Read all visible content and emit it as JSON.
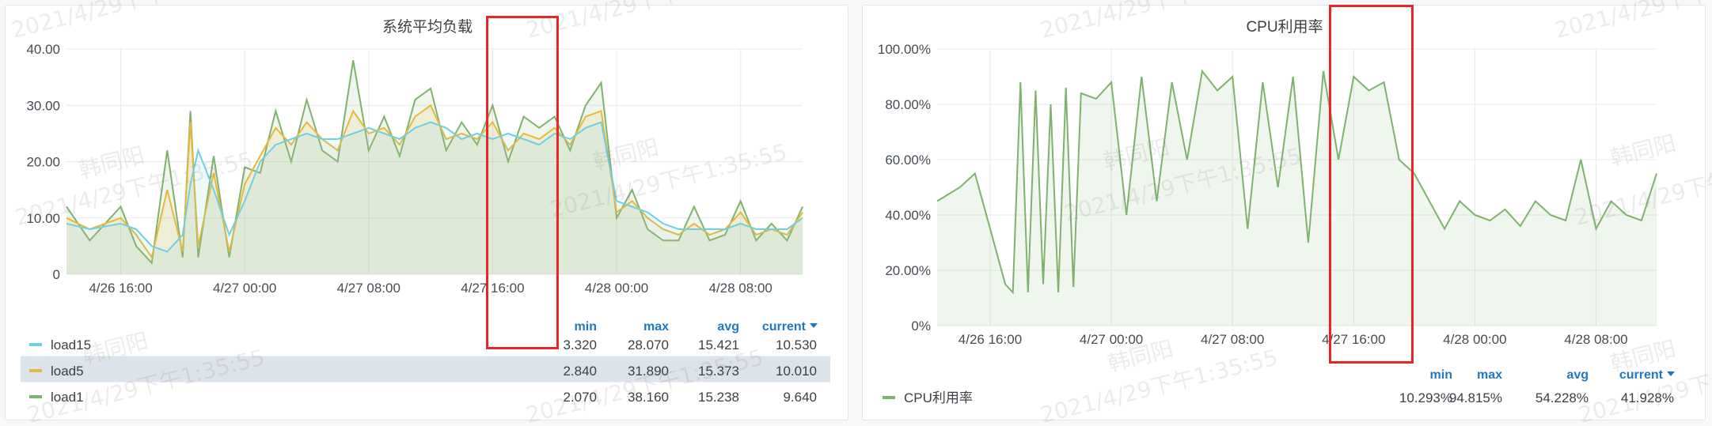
{
  "colors": {
    "load15": "#6ed0e0",
    "load5": "#eab839",
    "load1": "#7eb26d",
    "cpu": "#7eb26d",
    "legend_header": "#1f78c1",
    "highlight": "#e8262a",
    "grid": "#e8e9ec",
    "panel_border": "#e3e5e8",
    "selected_row": "#dde3ea"
  },
  "watermark": {
    "user": "韩同阳",
    "timestamp": "2021/4/29下午1:35:55"
  },
  "load_panel": {
    "title": "系统平均负载",
    "legend_headers": {
      "min": "min",
      "max": "max",
      "avg": "avg",
      "current": "current"
    },
    "sort_icon": "caret-down-icon",
    "legend_rows": [
      {
        "key": "load15",
        "name": "load15",
        "min": "3.320",
        "max": "28.070",
        "avg": "15.421",
        "current": "10.530",
        "selected": false
      },
      {
        "key": "load5",
        "name": "load5",
        "min": "2.840",
        "max": "31.890",
        "avg": "15.373",
        "current": "10.010",
        "selected": true
      },
      {
        "key": "load1",
        "name": "load1",
        "min": "2.070",
        "max": "38.160",
        "avg": "15.238",
        "current": "9.640",
        "selected": false
      }
    ]
  },
  "cpu_panel": {
    "title": "CPU利用率",
    "legend_headers": {
      "min": "min",
      "max": "max",
      "avg": "avg",
      "current": "current"
    },
    "sort_icon": "caret-down-icon",
    "legend_rows": [
      {
        "key": "cpu",
        "name": "CPU利用率",
        "min": "10.293%",
        "max": "94.815%",
        "avg": "54.228%",
        "current": "41.928%",
        "selected": false
      }
    ]
  },
  "chart_data": [
    {
      "type": "line",
      "title": "系统平均负载",
      "x_ticks": [
        "4/26 16:00",
        "4/27 00:00",
        "4/27 08:00",
        "4/27 16:00",
        "4/28 00:00",
        "4/28 08:00"
      ],
      "x_range_hours": [
        -3.5,
        44.0
      ],
      "y_ticks": [
        "0",
        "10.00",
        "20.00",
        "30.00",
        "40.00"
      ],
      "ylim": [
        0,
        40
      ],
      "grid": true,
      "fill": true,
      "legend": "bottom-table",
      "series": [
        {
          "name": "load15",
          "x_hours": [
            -3.5,
            -2,
            0,
            1,
            2,
            3,
            4,
            4.5,
            5,
            6,
            7,
            8,
            9,
            10,
            11,
            12,
            13,
            14,
            15,
            16,
            17,
            18,
            19,
            20,
            21,
            22,
            23,
            24,
            25,
            26,
            27,
            28,
            29,
            30,
            31,
            32,
            33,
            34,
            35,
            36,
            37,
            38,
            39,
            40,
            41,
            42,
            43,
            44
          ],
          "values": [
            9,
            8,
            9,
            8,
            5,
            4,
            7,
            16,
            22,
            15,
            7,
            13,
            20,
            23,
            24,
            25,
            24,
            24,
            25,
            26,
            25,
            24,
            26,
            27,
            26,
            24,
            25,
            24,
            25,
            24,
            23,
            25,
            24,
            26,
            27,
            13,
            12,
            11,
            9,
            8,
            8,
            8,
            8,
            9,
            8,
            8,
            8,
            10
          ]
        },
        {
          "name": "load5",
          "x_hours": [
            -3.5,
            -2,
            0,
            1,
            2,
            3,
            4,
            4.5,
            5,
            6,
            7,
            8,
            9,
            10,
            11,
            12,
            13,
            14,
            15,
            16,
            17,
            18,
            19,
            20,
            21,
            22,
            23,
            24,
            25,
            26,
            27,
            28,
            29,
            30,
            31,
            32,
            33,
            34,
            35,
            36,
            37,
            38,
            39,
            40,
            41,
            42,
            43,
            44
          ],
          "values": [
            10,
            8,
            10,
            7,
            3,
            15,
            4,
            27,
            5,
            18,
            4,
            16,
            21,
            26,
            23,
            27,
            24,
            22,
            29,
            25,
            26,
            23,
            28,
            30,
            24,
            25,
            24,
            27,
            22,
            25,
            24,
            26,
            23,
            28,
            29,
            11,
            13,
            10,
            8,
            7,
            9,
            7,
            8,
            11,
            7,
            8,
            7,
            11
          ]
        },
        {
          "name": "load1",
          "x_hours": [
            -3.5,
            -2,
            0,
            1,
            2,
            3,
            4,
            4.5,
            5,
            6,
            7,
            8,
            9,
            10,
            11,
            12,
            13,
            14,
            15,
            16,
            17,
            18,
            19,
            20,
            21,
            22,
            23,
            24,
            25,
            26,
            27,
            28,
            29,
            30,
            31,
            32,
            33,
            34,
            35,
            36,
            37,
            38,
            39,
            40,
            41,
            42,
            43,
            44
          ],
          "values": [
            12,
            6,
            12,
            5,
            2,
            22,
            3,
            29,
            3,
            21,
            3,
            19,
            18,
            29,
            20,
            31,
            22,
            20,
            38,
            22,
            28,
            21,
            31,
            33,
            22,
            27,
            23,
            30,
            20,
            28,
            26,
            28,
            22,
            30,
            34,
            10,
            15,
            8,
            6,
            6,
            12,
            6,
            7,
            13,
            6,
            9,
            6,
            12
          ]
        }
      ]
    },
    {
      "type": "line",
      "title": "CPU利用率",
      "x_ticks": [
        "4/26 16:00",
        "4/27 00:00",
        "4/27 08:00",
        "4/27 16:00",
        "4/28 00:00",
        "4/28 08:00"
      ],
      "x_range_hours": [
        -3.5,
        44.0
      ],
      "y_ticks": [
        "0%",
        "20.00%",
        "40.00%",
        "60.00%",
        "80.00%",
        "100.00%"
      ],
      "ylim": [
        0,
        100
      ],
      "grid": true,
      "fill": true,
      "legend": "bottom-table",
      "series": [
        {
          "name": "CPU利用率",
          "x_hours": [
            -3.5,
            -2,
            -1,
            0,
            1,
            1.5,
            2,
            2.5,
            3,
            3.5,
            4,
            4.5,
            5,
            5.5,
            6,
            7,
            8,
            9,
            10,
            11,
            12,
            13,
            14,
            15,
            16,
            17,
            18,
            19,
            20,
            21,
            22,
            23,
            24,
            25,
            26,
            27,
            28,
            29,
            30,
            31,
            32,
            33,
            34,
            35,
            36,
            37,
            38,
            39,
            40,
            41,
            42,
            43,
            44
          ],
          "values": [
            45,
            50,
            55,
            35,
            15,
            12,
            88,
            12,
            85,
            15,
            80,
            12,
            86,
            14,
            84,
            82,
            88,
            40,
            90,
            45,
            88,
            60,
            92,
            85,
            90,
            35,
            88,
            50,
            90,
            30,
            92,
            60,
            90,
            85,
            88,
            60,
            55,
            45,
            35,
            45,
            40,
            38,
            42,
            36,
            45,
            40,
            38,
            60,
            35,
            45,
            40,
            38,
            55
          ]
        }
      ]
    }
  ]
}
